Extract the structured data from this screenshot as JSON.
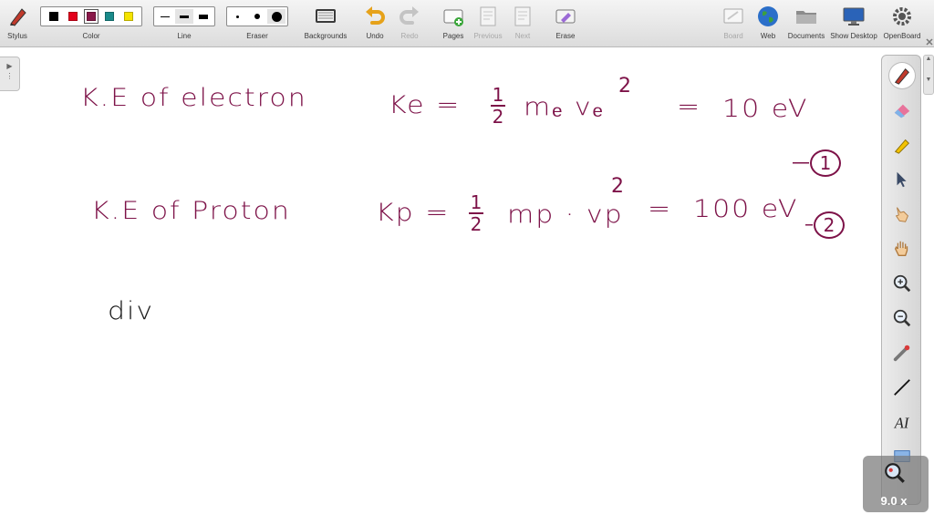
{
  "toolbar": {
    "stylus": {
      "label": "Stylus",
      "icon": "stylus-icon"
    },
    "color": {
      "label": "Color",
      "swatches": [
        "#000000",
        "#e3001b",
        "#8a1a4a",
        "#1a8a8a",
        "#f5e400"
      ],
      "selected": 2
    },
    "line": {
      "label": "Line",
      "options": [
        "thin",
        "medium",
        "thick"
      ]
    },
    "eraser": {
      "label": "Eraser",
      "options": [
        "small",
        "medium",
        "large"
      ]
    },
    "backgrounds": {
      "label": "Backgrounds",
      "icon": "keyboard-icon"
    },
    "undo": {
      "label": "Undo",
      "icon": "undo-icon"
    },
    "redo": {
      "label": "Redo",
      "icon": "redo-icon"
    },
    "pages": {
      "label": "Pages",
      "icon": "add-page-icon"
    },
    "previous": {
      "label": "Previous",
      "icon": "previous-page-icon"
    },
    "next": {
      "label": "Next",
      "icon": "next-page-icon"
    },
    "erase": {
      "label": "Erase",
      "icon": "erase-page-icon"
    },
    "board": {
      "label": "Board",
      "icon": "board-icon"
    },
    "web": {
      "label": "Web",
      "icon": "globe-icon"
    },
    "documents": {
      "label": "Documents",
      "icon": "folder-icon"
    },
    "show_desktop": {
      "label": "Show Desktop",
      "icon": "monitor-icon"
    },
    "openboard": {
      "label": "OpenBoard",
      "icon": "gear-icon"
    }
  },
  "palette_tools": [
    "pen",
    "eraser",
    "marker",
    "selector",
    "interactor",
    "hand",
    "zoom-in",
    "zoom-out",
    "laser-pointer",
    "line",
    "text",
    "capture"
  ],
  "magnifier": {
    "zoom": "9.0 x"
  },
  "board": {
    "line1": {
      "prefix": "K.E of electron",
      "lhs": "Ke =",
      "frac_num": "1",
      "frac_den": "2",
      "rhs": "mₑ vₑ",
      "sup": "2",
      "eq": "=",
      "value": "10 eV"
    },
    "line2": {
      "prefix": "K.E of Proton",
      "lhs": "Kp =",
      "frac_num": "1",
      "frac_den": "2",
      "rhs": "mp · vp",
      "sup": "2",
      "eq": "=",
      "value": "100 eV"
    },
    "marker1": "1",
    "marker2": "2",
    "line3": "div"
  },
  "ink_color": "#7d1248"
}
